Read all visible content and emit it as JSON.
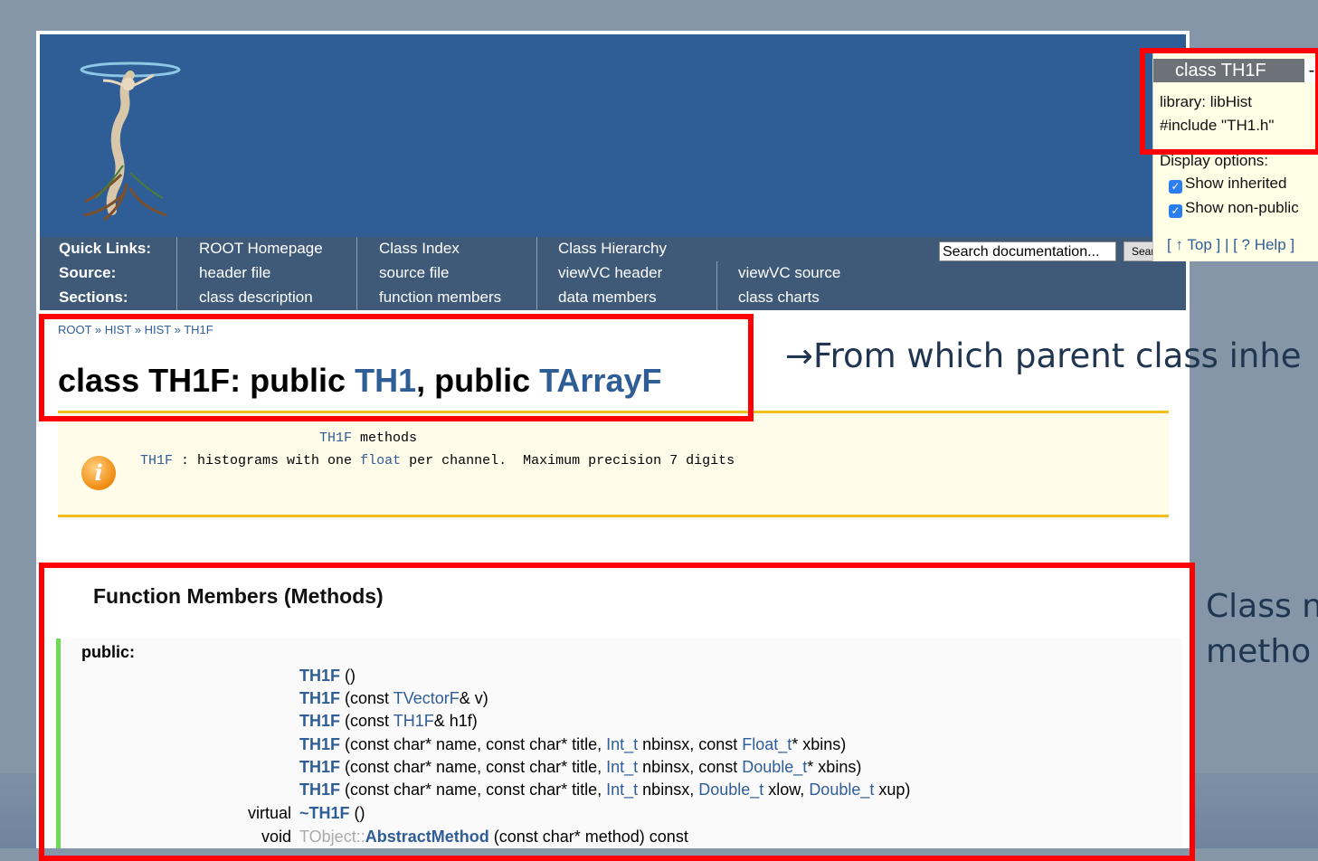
{
  "header_logo": "root-logo",
  "nav": {
    "quick_links_label": "Quick Links:",
    "source_label": "Source:",
    "sections_label": "Sections:",
    "root_homepage": "ROOT Homepage",
    "class_index": "Class Index",
    "class_hierarchy": "Class Hierarchy",
    "header_file": "header file",
    "source_file": "source file",
    "viewvc_header": "viewVC header",
    "viewvc_source": "viewVC source",
    "class_description": "class description",
    "function_members": "function members",
    "data_members": "data members",
    "class_charts": "class charts",
    "search_placeholder": "Search documentation...",
    "search_button": "Search"
  },
  "panel": {
    "title": "class TH1F",
    "close": "-",
    "library": "library: libHist",
    "include": "#include \"TH1.h\"",
    "display_options": "Display options:",
    "show_inherited": "Show inherited",
    "show_non_public": "Show non-public",
    "links": "[ ↑ Top ] | [ ? Help ]"
  },
  "breadcrumb": "ROOT » HIST » HIST » TH1F",
  "class_title": {
    "prefix": "class TH1F: public ",
    "parent1": "TH1",
    "mid": ", public ",
    "parent2": "TArrayF"
  },
  "description": {
    "methods_name": "TH1F",
    "methods_text": " methods",
    "line_name": "TH1F",
    "line_text1": " : histograms with one ",
    "line_float": "float",
    "line_text2": " per channel.  Maximum precision 7 digits"
  },
  "function_members": {
    "title": "Function Members (Methods)",
    "public_label": "public:",
    "methods": [
      {
        "name": "TH1F",
        "args": " ()"
      },
      {
        "name": "TH1F",
        "a1": " (const ",
        "t1": "TVectorF",
        "a2": "& v)"
      },
      {
        "name": "TH1F",
        "a1": " (const ",
        "t1": "TH1F",
        "a2": "& h1f)"
      },
      {
        "name": "TH1F",
        "a1": " (const char* name, const char* title, ",
        "t1": "Int_t",
        "a2": " nbinsx, const ",
        "t2": "Float_t",
        "a3": "* xbins)"
      },
      {
        "name": "TH1F",
        "a1": " (const char* name, const char* title, ",
        "t1": "Int_t",
        "a2": " nbinsx, const ",
        "t2": "Double_t",
        "a3": "* xbins)"
      },
      {
        "name": "TH1F",
        "a1": " (const char* name, const char* title, ",
        "t1": "Int_t",
        "a2": " nbinsx, ",
        "t2": "Double_t",
        "a3": " xlow, ",
        "t3": "Double_t",
        "a4": " xup)"
      },
      {
        "ret": "virtual",
        "name": "~TH1F",
        "args": " ()"
      },
      {
        "ret": "void",
        "scope": "TObject::",
        "name": "AbstractMethod",
        "args": " (const char* method) const"
      }
    ]
  },
  "annotations": {
    "parent": "→From which parent class inhe",
    "class_line1": "Class n",
    "class_line2": "metho"
  },
  "colors": {
    "header_bg": "#2f5d96",
    "nav_bg": "#3f5a78",
    "link": "#2f5d96",
    "highlight_box": "#ff0000",
    "inherit_bar": "#6fdb55",
    "desc_border": "#f0c020"
  }
}
